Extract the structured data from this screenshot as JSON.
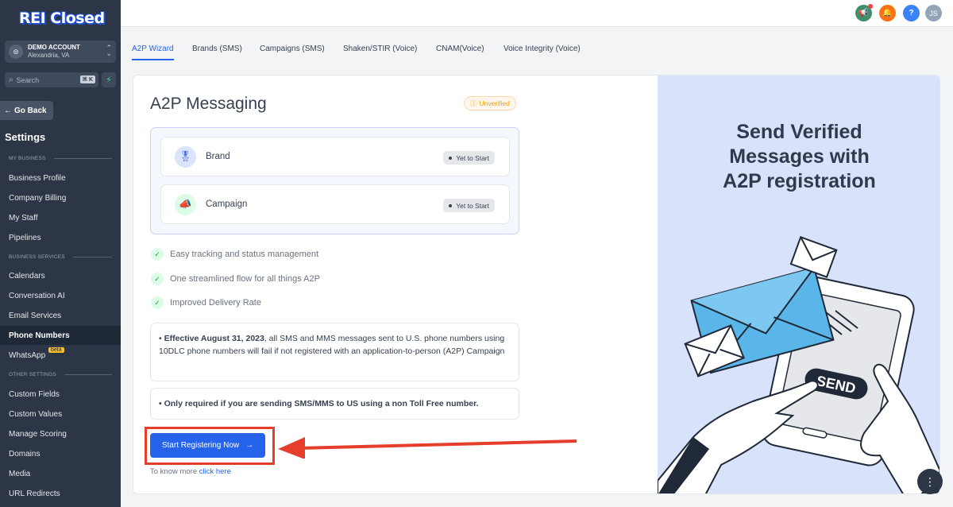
{
  "app": {
    "logo": "REI Closed"
  },
  "account": {
    "name": "DEMO ACCOUNT",
    "location": "Alexandria, VA"
  },
  "search": {
    "placeholder": "Search",
    "shortcut": "⌘ K"
  },
  "sidebar": {
    "go_back": "Go Back",
    "heading": "Settings",
    "sections": {
      "my_business": "MY BUSINESS",
      "business_services": "BUSINESS SERVICES",
      "other_settings": "OTHER SETTINGS"
    },
    "items": {
      "business_profile": "Business Profile",
      "company_billing": "Company Billing",
      "my_staff": "My Staff",
      "pipelines": "Pipelines",
      "calendars": "Calendars",
      "conversation_ai": "Conversation AI",
      "email_services": "Email Services",
      "phone_numbers": "Phone Numbers",
      "whatsapp": "WhatsApp",
      "whatsapp_badge": "beta",
      "custom_fields": "Custom Fields",
      "custom_values": "Custom Values",
      "manage_scoring": "Manage Scoring",
      "domains": "Domains",
      "media": "Media",
      "url_redirects": "URL Redirects"
    }
  },
  "topbar": {
    "avatar_initials": "JS",
    "help": "?",
    "colors": {
      "megaphone": "#3f8f6b",
      "bell": "#f97316",
      "help": "#3b82f6",
      "avatar": "#94a3b8"
    }
  },
  "tabs": {
    "a2p_wizard": "A2P Wizard",
    "brands": "Brands (SMS)",
    "campaigns": "Campaigns (SMS)",
    "shaken": "Shaken/STIR (Voice)",
    "cnam": "CNAM(Voice)",
    "voice_integrity": "Voice Integrity (Voice)"
  },
  "main": {
    "title": "A2P Messaging",
    "status_badge": "Unverified",
    "steps": {
      "brand": {
        "label": "Brand",
        "status": "Yet to Start"
      },
      "campaign": {
        "label": "Campaign",
        "status": "Yet to Start"
      }
    },
    "features": {
      "f1": "Easy tracking and status management",
      "f2": "One streamlined flow for all things A2P",
      "f3": "Improved Delivery Rate"
    },
    "notice1": {
      "bold": "Effective August 31, 2023",
      "text": ", all SMS and MMS messages sent to U.S. phone numbers using 10DLC phone numbers will fail if not registered with an application-to-person (A2P) Campaign"
    },
    "notice2": {
      "text": "Only required if you are sending SMS/MMS to US using a non Toll Free number."
    },
    "cta": "Start Registering Now",
    "know_more": "To know more",
    "click_here": "click here",
    "accent": "#2563eb",
    "annotation_color": "#e53e2b"
  },
  "promo": {
    "line1": "Send Verified",
    "line2": "Messages with",
    "line3": "A2P registration",
    "phone_button": "SEND"
  }
}
